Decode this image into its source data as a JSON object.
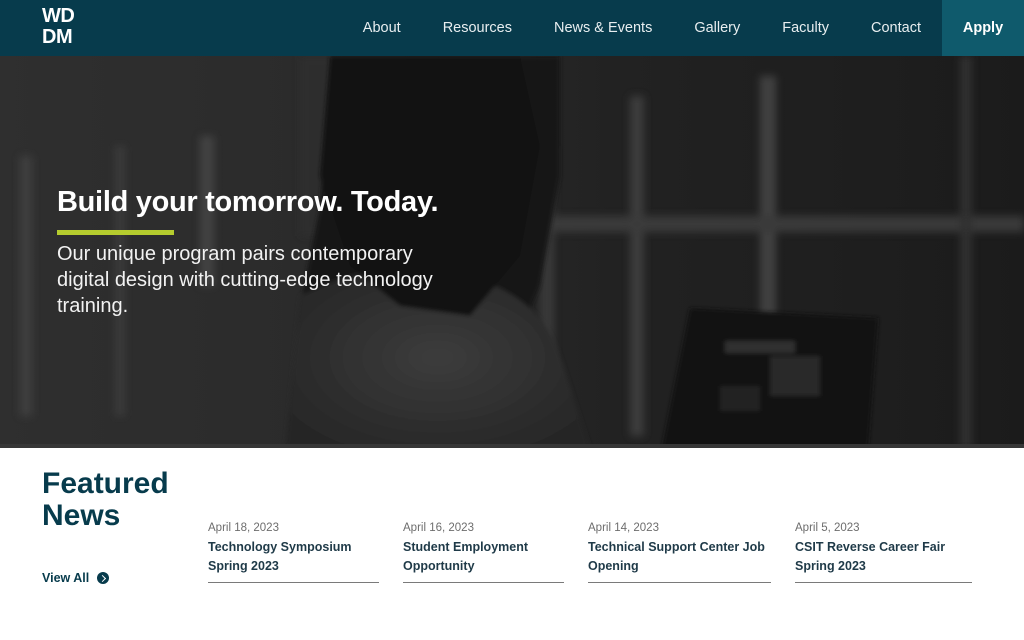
{
  "header": {
    "logo": {
      "line1": "WD",
      "line2": "DM"
    },
    "nav": [
      {
        "label": "About"
      },
      {
        "label": "Resources"
      },
      {
        "label": "News & Events"
      },
      {
        "label": "Gallery"
      },
      {
        "label": "Faculty"
      },
      {
        "label": "Contact"
      }
    ],
    "apply_label": "Apply"
  },
  "hero": {
    "title": "Build your tomorrow. Today.",
    "text": "Our unique program pairs contemporary digital design with cutting-edge technology training.",
    "accent_color": "#b5cc2e",
    "image_description": "grayscale photo of a student with long hair working on a laptop"
  },
  "featured": {
    "title_line1": "Featured",
    "title_line2": "News",
    "view_all_label": "View All",
    "view_all_icon": "chevron-circle-right-icon",
    "items": [
      {
        "date": "April 18, 2023",
        "title": "Technology Symposium Spring 2023"
      },
      {
        "date": "April 16, 2023",
        "title": "Student Employment Opportunity"
      },
      {
        "date": "April 14, 2023",
        "title": "Technical Support Center Job Opening"
      },
      {
        "date": "April 5, 2023",
        "title": "CSIT Reverse Career Fair Spring 2023"
      }
    ]
  },
  "colors": {
    "brand": "#073b4c",
    "apply_bg": "#0f5a6c",
    "accent": "#b5cc2e"
  }
}
